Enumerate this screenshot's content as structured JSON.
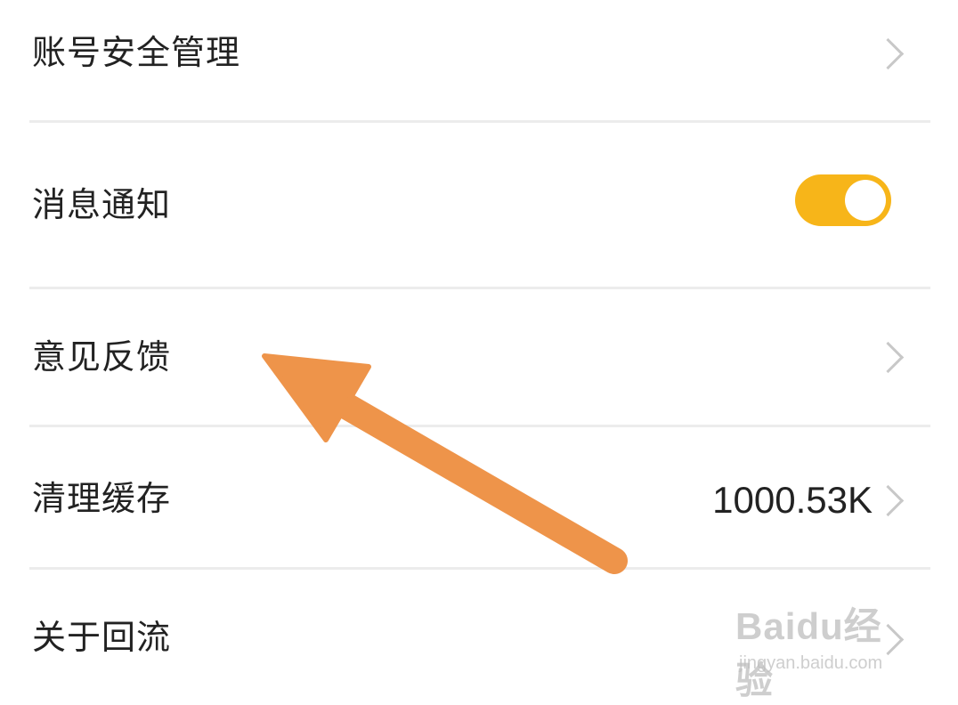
{
  "settings": {
    "items": [
      {
        "label": "账号安全管理",
        "control": "chevron-right-icon"
      },
      {
        "label": "消息通知",
        "control": "toggle",
        "toggle_on": true
      },
      {
        "label": "意见反馈",
        "control": "chevron-right-icon"
      },
      {
        "label": "清理缓存",
        "control": "chevron-right-icon",
        "value": "1000.53K"
      },
      {
        "label": "关于回流",
        "control": "chevron-right-icon"
      }
    ]
  },
  "colors": {
    "toggle_on": "#f7b519",
    "arrow": "#ee944a",
    "chevron": "#c8c8c8",
    "text": "#222222"
  },
  "annotation": {
    "icon": "arrow-pointer-icon"
  },
  "watermark": {
    "brand": "Baidu经验",
    "url": "jingyan.baidu.com"
  }
}
